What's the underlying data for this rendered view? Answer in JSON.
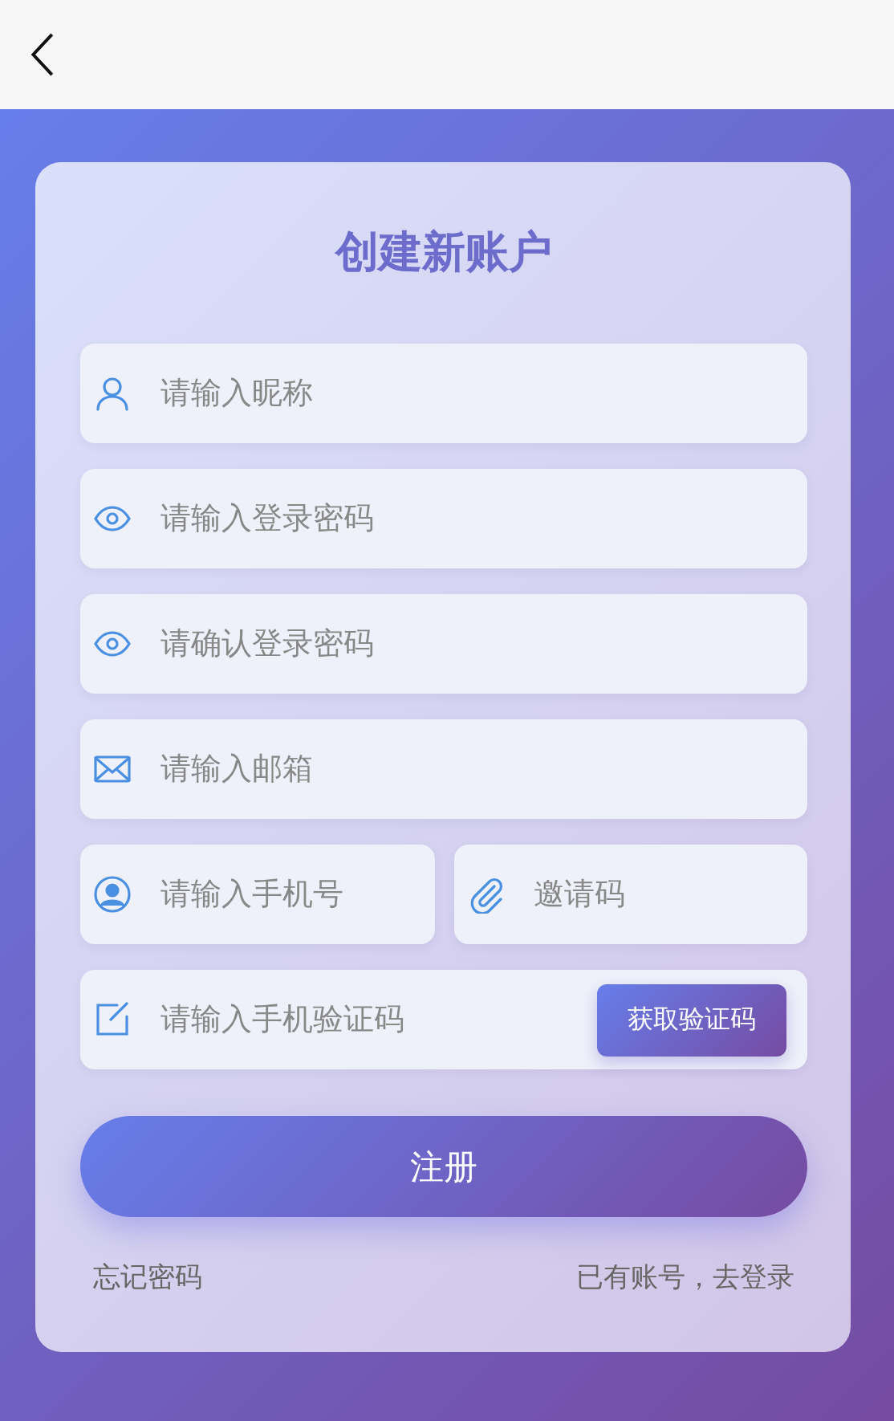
{
  "title": "创建新账户",
  "fields": [
    {
      "placeholder": "请输入昵称"
    },
    {
      "placeholder": "请输入登录密码"
    },
    {
      "placeholder": "请确认登录密码"
    },
    {
      "placeholder": "请输入邮箱"
    }
  ],
  "split_row": [
    {
      "placeholder": "请输入手机号"
    },
    {
      "placeholder": "邀请码"
    }
  ],
  "code_row": {
    "placeholder": "请输入手机验证码",
    "button": "获取验证码"
  },
  "submit": "注册",
  "links": [
    "忘记密码",
    "已有账号，去登录"
  ]
}
